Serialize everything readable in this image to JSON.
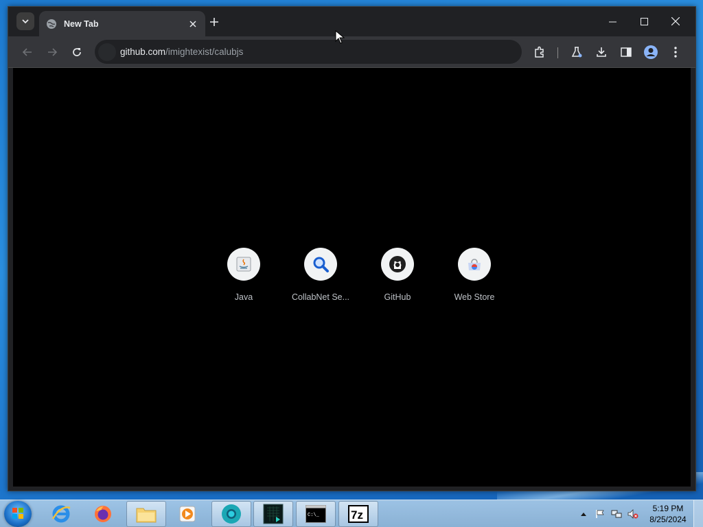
{
  "browser": {
    "tab": {
      "title": "New Tab"
    },
    "omnibox": {
      "domain": "github.com",
      "path": "/imightexist/calubjs"
    }
  },
  "shortcuts": [
    {
      "label": "Java",
      "icon": "java-icon"
    },
    {
      "label": "CollabNet Se...",
      "icon": "search-magnifier-icon"
    },
    {
      "label": "GitHub",
      "icon": "github-icon"
    },
    {
      "label": "Web Store",
      "icon": "web-store-icon"
    }
  ],
  "taskbar": {
    "apps": [
      {
        "name": "internet-explorer-icon"
      },
      {
        "name": "firefox-icon"
      },
      {
        "name": "file-explorer-icon"
      },
      {
        "name": "media-player-icon"
      },
      {
        "name": "chrome-icon"
      },
      {
        "name": "terminal-app-icon"
      },
      {
        "name": "command-prompt-icon"
      },
      {
        "name": "7zip-icon"
      }
    ],
    "clock": {
      "time": "5:19 PM",
      "date": "8/25/2024"
    },
    "cmd_label": "C:\\_",
    "sevenzip_label": "7z"
  },
  "colors": {
    "tab_bg": "#35363a",
    "frame_bg": "#202124",
    "content_bg": "#000000",
    "shortcut_circle": "#f1f3f4"
  }
}
